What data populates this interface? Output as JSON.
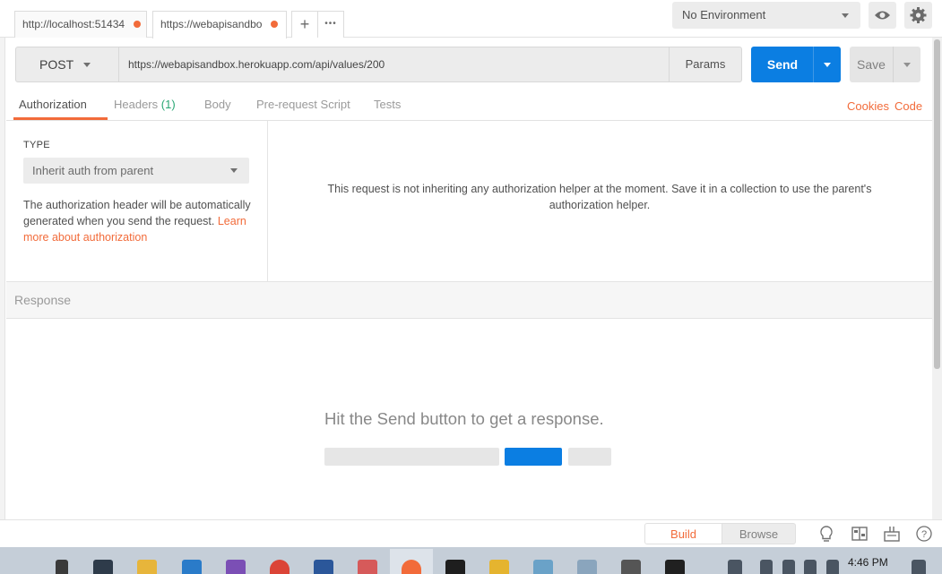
{
  "tabs": [
    {
      "label": "http://localhost:51434",
      "unsaved": true,
      "active": false
    },
    {
      "label": "https://webapisandbo",
      "unsaved": true,
      "active": true
    }
  ],
  "tab_tools": {
    "new_tab": "+",
    "more": "•••"
  },
  "environment": {
    "selected": "No Environment"
  },
  "request": {
    "method": "POST",
    "url": "https://webapisandbox.herokuapp.com/api/values/200",
    "params_label": "Params",
    "send_label": "Send",
    "save_label": "Save"
  },
  "request_tabs": {
    "authorization": "Authorization",
    "headers": "Headers",
    "headers_count": "(1)",
    "body": "Body",
    "prerequest": "Pre-request Script",
    "tests": "Tests",
    "cookies": "Cookies",
    "code": "Code"
  },
  "auth": {
    "type_label": "TYPE",
    "type_value": "Inherit auth from parent",
    "note": "The authorization header will be automatically generated when you send the request.",
    "learn_more": "Learn more about authorization",
    "message": "This request is not inheriting any authorization helper at the moment. Save it in a collection to use the parent's authorization helper."
  },
  "response": {
    "title": "Response",
    "hint": "Hit the Send button to get a response."
  },
  "statusbar": {
    "build": "Build",
    "browse": "Browse"
  },
  "taskbar": {
    "time": "4:46 PM"
  },
  "colors": {
    "accent": "#f26b3a",
    "send_blue": "#0b7ee2",
    "headers_green": "#2aa774"
  }
}
